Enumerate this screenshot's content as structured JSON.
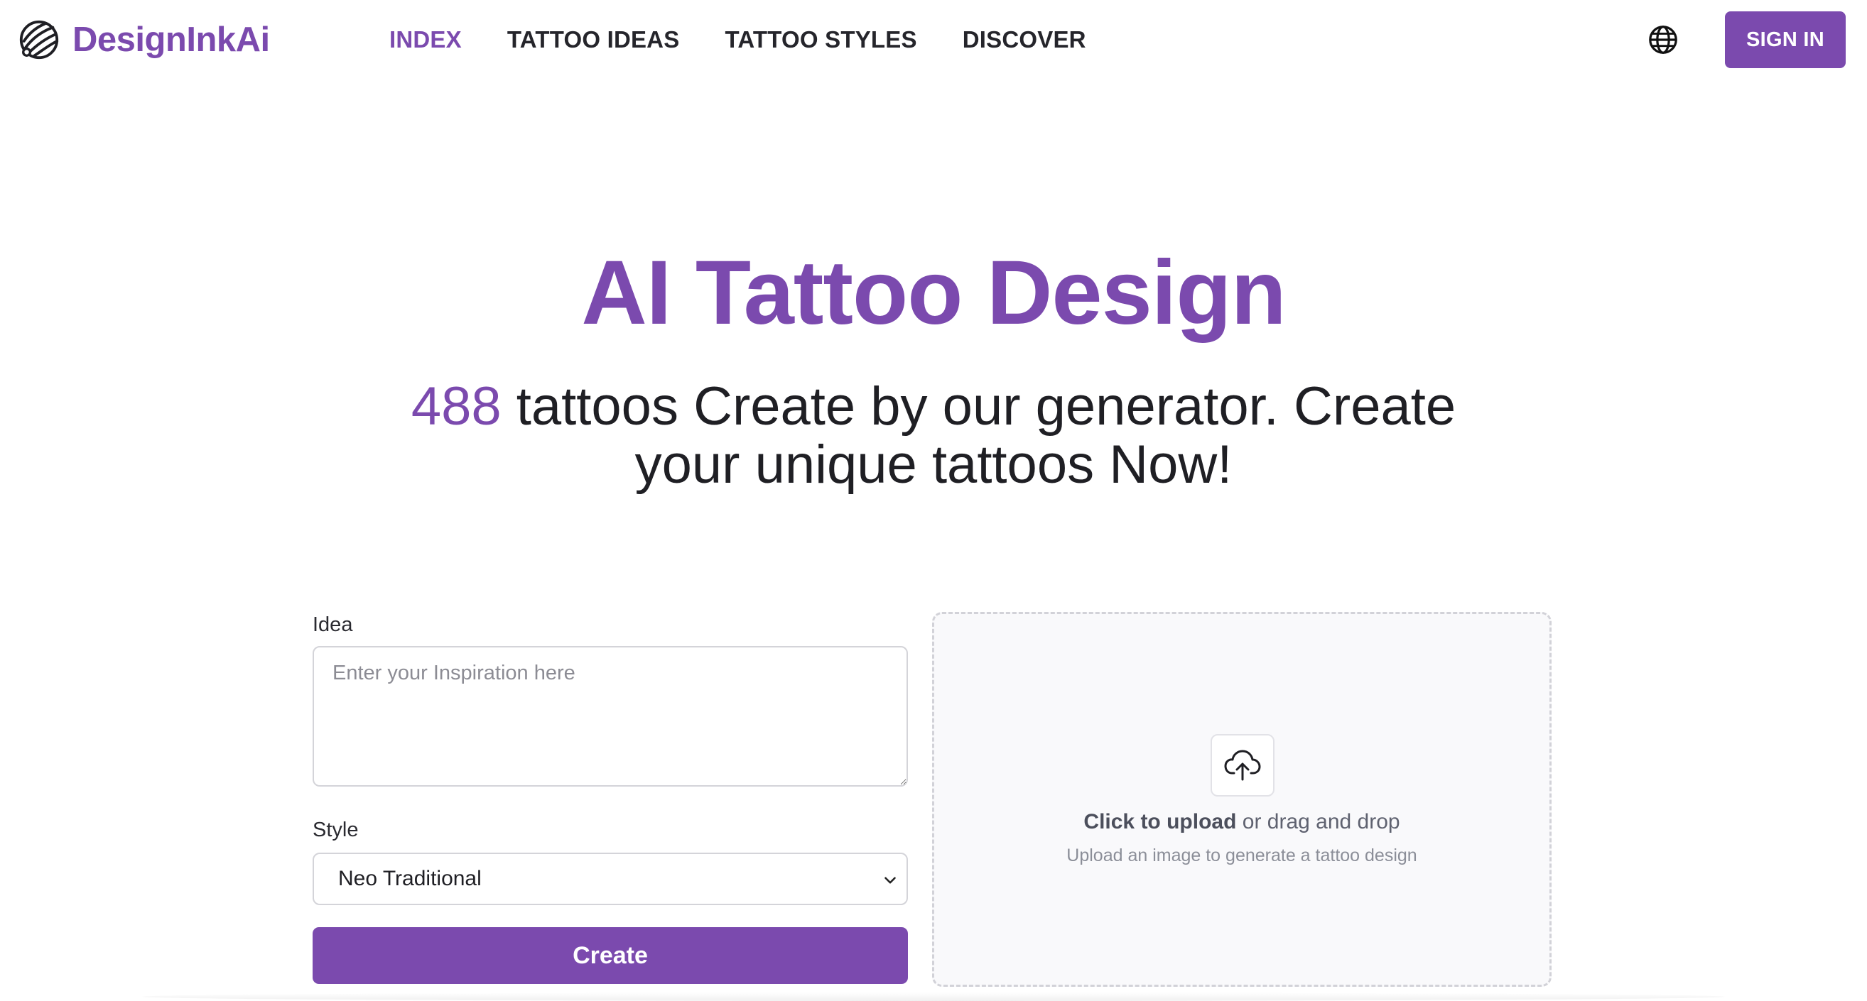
{
  "brand": {
    "name": "DesignInkAi",
    "color": "#7b4aae",
    "logo_icon": "stylized-ink-swirl-icon"
  },
  "nav": {
    "items": [
      {
        "label": "INDEX",
        "active": true
      },
      {
        "label": "TATTOO IDEAS",
        "active": false
      },
      {
        "label": "TATTOO STYLES",
        "active": false
      },
      {
        "label": "DISCOVER",
        "active": false
      }
    ],
    "language_icon": "globe-icon",
    "sign_in_label": "SIGN IN"
  },
  "hero": {
    "title": "AI Tattoo Design",
    "count": "488",
    "subtitle_rest": " tattoos Create by our generator. Create your unique tattoos Now!"
  },
  "form": {
    "idea_label": "Idea",
    "idea_placeholder": "Enter your Inspiration here",
    "idea_value": "",
    "style_label": "Style",
    "style_value": "Neo Traditional",
    "create_label": "Create"
  },
  "upload": {
    "icon": "cloud-upload-icon",
    "click_text": "Click to upload",
    "drag_text": " or drag and drop",
    "hint": "Upload an image to generate a tattoo design"
  }
}
